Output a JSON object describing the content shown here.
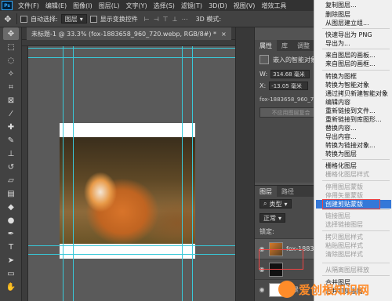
{
  "menubar": {
    "items": [
      "文件(F)",
      "编辑(E)",
      "图像(I)",
      "图层(L)",
      "文字(Y)",
      "选择(S)",
      "滤镜(T)",
      "3D(D)",
      "视图(V)",
      "增效工具"
    ],
    "logo": "Ps"
  },
  "options": {
    "auto_select_label": "自动选择:",
    "auto_select_value": "图层",
    "show_transform_label": "显示变换控件",
    "mode_3d": "3D 模式:"
  },
  "document": {
    "tab_title": "未标题-1 @ 33.3% (fox-1883658_960_720.webp, RGB/8#) *",
    "close_glyph": "×"
  },
  "properties": {
    "tabs": [
      "属性",
      "库",
      "调整"
    ],
    "object_type": "嵌入的智能对象",
    "w_label": "W:",
    "w_value": "314.68 毫米",
    "x_label": "X:",
    "x_value": "-13.05 毫米",
    "file_name": "fox-1883658_960_720.webp",
    "disabled_button": "不应用图层复合"
  },
  "layers": {
    "tabs": [
      "图层",
      "路径"
    ],
    "filter_type": "类型",
    "blend_mode": "正常",
    "lock_label": "锁定:",
    "items": [
      {
        "name": "fox-1883...",
        "thumb": "fox",
        "selected": true
      },
      {
        "name": "",
        "thumb": "black",
        "selected": false
      },
      {
        "name": "背景",
        "thumb": "white",
        "selected": false
      }
    ]
  },
  "context_menu": {
    "items": [
      {
        "label": "复制图层...",
        "disabled": false
      },
      {
        "label": "删除图层",
        "disabled": false
      },
      {
        "label": "从图层建立组...",
        "disabled": false
      },
      {
        "label": "快速导出为 PNG",
        "disabled": false
      },
      {
        "label": "导出为...",
        "disabled": false
      },
      {
        "label": "来自图层的画板...",
        "disabled": false
      },
      {
        "label": "来自图层的画框...",
        "disabled": false
      },
      {
        "label": "转换为图框",
        "disabled": false
      },
      {
        "label": "转换为智能对象",
        "disabled": false
      },
      {
        "label": "通过拷贝新建智能对象",
        "disabled": false
      },
      {
        "label": "编辑内容",
        "disabled": false
      },
      {
        "label": "重新链接到文件...",
        "disabled": false
      },
      {
        "label": "重新链接到库图形...",
        "disabled": false
      },
      {
        "label": "替换内容...",
        "disabled": false
      },
      {
        "label": "导出内容...",
        "disabled": false
      },
      {
        "label": "转换为链接对象...",
        "disabled": false
      },
      {
        "label": "转换为图层",
        "disabled": false
      },
      {
        "label": "栅格化图层",
        "disabled": false
      },
      {
        "label": "栅格化图层样式",
        "disabled": true
      },
      {
        "label": "停用图层蒙版",
        "disabled": true
      },
      {
        "label": "停用矢量蒙版",
        "disabled": true
      },
      {
        "label": "创建剪贴蒙版",
        "disabled": false,
        "active": true
      },
      {
        "label": "链接图层",
        "disabled": true
      },
      {
        "label": "选择链接图层",
        "disabled": true
      },
      {
        "label": "拷贝图层样式",
        "disabled": true
      },
      {
        "label": "粘贴图层样式",
        "disabled": true
      },
      {
        "label": "清除图层样式",
        "disabled": true
      },
      {
        "label": "从隔离图层释放",
        "disabled": true
      },
      {
        "label": "合并图层",
        "disabled": false
      },
      {
        "label": "合并可见图层",
        "disabled": false
      }
    ],
    "highlight_color": "#3478d8"
  },
  "watermark": {
    "text": "爱创根知识网"
  }
}
